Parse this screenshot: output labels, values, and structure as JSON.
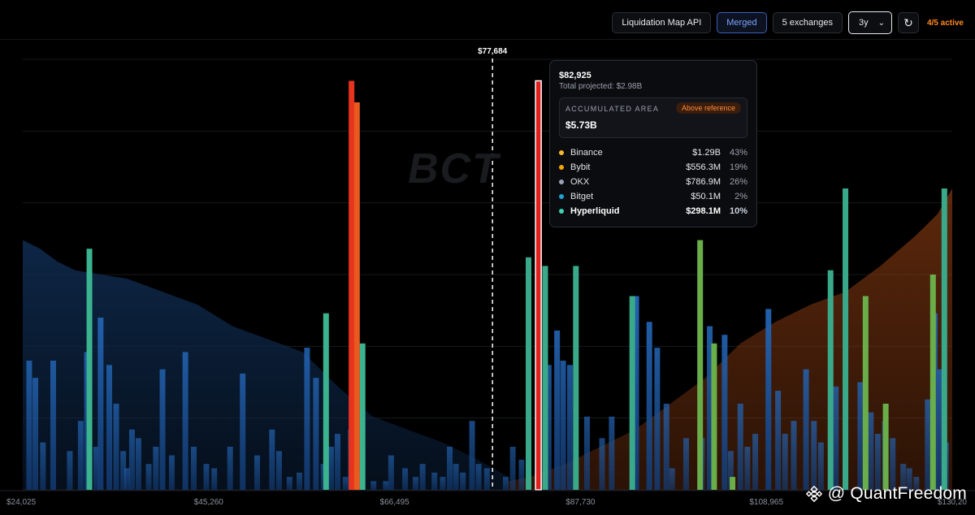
{
  "toolbar": {
    "api_label": "Liquidation Map API",
    "merged_label": "Merged",
    "exchanges_label": "5 exchanges",
    "range_value": "3y",
    "active_label": "4/5 active"
  },
  "logo_text": "BCT",
  "watermark": {
    "text": "@ QuantFreedom"
  },
  "colors": {
    "background": "#000000",
    "below_bars": "#1d5ea8",
    "hyperliquid": "#3fc6a0",
    "above_area": "#7a3510",
    "below_area": "#0f2a4d",
    "reference_line": "#ffffff",
    "selected_bar": "#e0201c",
    "accent_orange": "#ff8a1e"
  },
  "tooltip": {
    "price": "$82,925",
    "total": "Total projected: $2.98B",
    "area_label": "ACCUMULATED AREA",
    "area_badge": "Above reference",
    "area_value": "$5.73B",
    "rows": [
      {
        "name": "Binance",
        "value": "$1.29B",
        "pct": "43%",
        "color": "#f3ba2f"
      },
      {
        "name": "Bybit",
        "value": "$556.3M",
        "pct": "19%",
        "color": "#f7a600"
      },
      {
        "name": "OKX",
        "value": "$786.9M",
        "pct": "26%",
        "color": "#9aa4b8"
      },
      {
        "name": "Bitget",
        "value": "$50.1M",
        "pct": "2%",
        "color": "#1da2d6"
      },
      {
        "name": "Hyperliquid",
        "value": "$298.1M",
        "pct": "10%",
        "color": "#3fd4b4"
      }
    ]
  },
  "chart_data": {
    "type": "bar",
    "title": "",
    "xlabel": "",
    "ylabel": "",
    "reference_price": 77684,
    "reference_label": "$77,684",
    "selected_price": 82925,
    "x_range": [
      24025,
      130200
    ],
    "x_ticks": [
      "$24,025",
      "$45,260",
      "$66,495",
      "$87,730",
      "$108,965",
      "$130,20"
    ],
    "x_tick_values": [
      24025,
      45260,
      66495,
      87730,
      108965,
      130200
    ],
    "ylim": [
      0,
      1
    ],
    "grid": true,
    "series": [
      {
        "side": "below",
        "type": "bars",
        "x": [
          24760,
          25470,
          26330,
          27500,
          29400,
          30650,
          31370,
          32410,
          32920,
          33910,
          34700,
          35500,
          35950,
          36500,
          37240,
          38410,
          39230,
          39990,
          41050,
          42600,
          43560,
          45000,
          45900,
          47710,
          49150,
          50800,
          52500,
          53300,
          54500,
          55630,
          56500,
          57520,
          58380,
          59250,
          59990,
          60900,
          61500,
          62750,
          64090,
          65500,
          66100,
          67700,
          68900,
          69700,
          71050,
          72000,
          72800,
          73500,
          74300,
          75350,
          76100,
          77050,
          79200,
          80000,
          81000
        ],
        "values": [
          0.3,
          0.26,
          0.11,
          0.3,
          0.09,
          0.16,
          0.32,
          0.1,
          0.4,
          0.29,
          0.2,
          0.09,
          0.05,
          0.14,
          0.12,
          0.06,
          0.1,
          0.28,
          0.08,
          0.32,
          0.1,
          0.06,
          0.05,
          0.1,
          0.27,
          0.08,
          0.14,
          0.09,
          0.03,
          0.04,
          0.33,
          0.26,
          0.06,
          0.1,
          0.13,
          0.03,
          0.14,
          0.05,
          0.02,
          0.02,
          0.08,
          0.05,
          0.03,
          0.06,
          0.04,
          0.03,
          0.1,
          0.06,
          0.04,
          0.16,
          0.06,
          0.05,
          0.03,
          0.1,
          0.07
        ]
      },
      {
        "side": "below",
        "type": "teal-bars",
        "x": [
          31640,
          58670,
          62840
        ],
        "values": [
          0.56,
          0.41,
          0.34
        ]
      },
      {
        "side": "above",
        "type": "bars",
        "x": [
          84100,
          85060,
          85750,
          86530,
          88480,
          90200,
          91300,
          94100,
          95600,
          96500,
          97550,
          98200,
          99800,
          101600,
          102500,
          104200,
          104900,
          106000,
          106800,
          107700,
          109200,
          110300,
          111100,
          112100,
          113500,
          114400,
          115200,
          116900,
          118000,
          119700,
          120900,
          121700,
          122500,
          123400,
          124600,
          125300,
          126100,
          127400,
          128200,
          128800,
          129500
        ],
        "values": [
          0.29,
          0.37,
          0.3,
          0.29,
          0.17,
          0.12,
          0.17,
          0.45,
          0.39,
          0.33,
          0.2,
          0.05,
          0.12,
          0.12,
          0.38,
          0.36,
          0.09,
          0.2,
          0.1,
          0.13,
          0.42,
          0.23,
          0.13,
          0.16,
          0.28,
          0.16,
          0.11,
          0.24,
          0.09,
          0.25,
          0.18,
          0.13,
          0.16,
          0.12,
          0.06,
          0.05,
          0.03,
          0.21,
          0.41,
          0.28,
          0.11
        ]
      },
      {
        "side": "above",
        "type": "teal-bars",
        "x": [
          87210,
          93650,
          116300,
          118000,
          129300
        ],
        "values": [
          0.52,
          0.45,
          0.51,
          0.7,
          0.7
        ]
      },
      {
        "side": "above",
        "type": "green-bars",
        "x": [
          101400,
          103000,
          105100,
          120300,
          122600,
          128000
        ],
        "values": [
          0.58,
          0.34,
          0.03,
          0.45,
          0.2,
          0.5
        ]
      },
      {
        "side": "below",
        "type": "liquidation-spike",
        "x": [
          61580,
          62200
        ],
        "values": [
          0.95,
          0.9
        ]
      },
      {
        "side": "above",
        "type": "selected",
        "x": [
          82925
        ],
        "values": [
          0.95
        ]
      },
      {
        "side": "above",
        "type": "teal-bars",
        "x": [
          81800,
          83700
        ],
        "values": [
          0.54,
          0.52
        ]
      }
    ],
    "cumulative_below": {
      "x": [
        24025,
        26000,
        28000,
        30000,
        33000,
        36000,
        40000,
        44000,
        48000,
        52000,
        56000,
        60000,
        64000,
        68000,
        72000,
        76000,
        79500
      ],
      "values": [
        0.58,
        0.56,
        0.53,
        0.51,
        0.5,
        0.49,
        0.46,
        0.43,
        0.38,
        0.35,
        0.32,
        0.24,
        0.17,
        0.14,
        0.11,
        0.07,
        0.03
      ]
    },
    "cumulative_above": {
      "x": [
        79500,
        82000,
        86000,
        90000,
        94000,
        98000,
        102000,
        106000,
        110000,
        114000,
        118000,
        122000,
        126000,
        128500,
        130200
      ],
      "values": [
        0.02,
        0.03,
        0.06,
        0.1,
        0.14,
        0.2,
        0.26,
        0.34,
        0.39,
        0.43,
        0.46,
        0.52,
        0.59,
        0.64,
        0.7
      ]
    }
  }
}
